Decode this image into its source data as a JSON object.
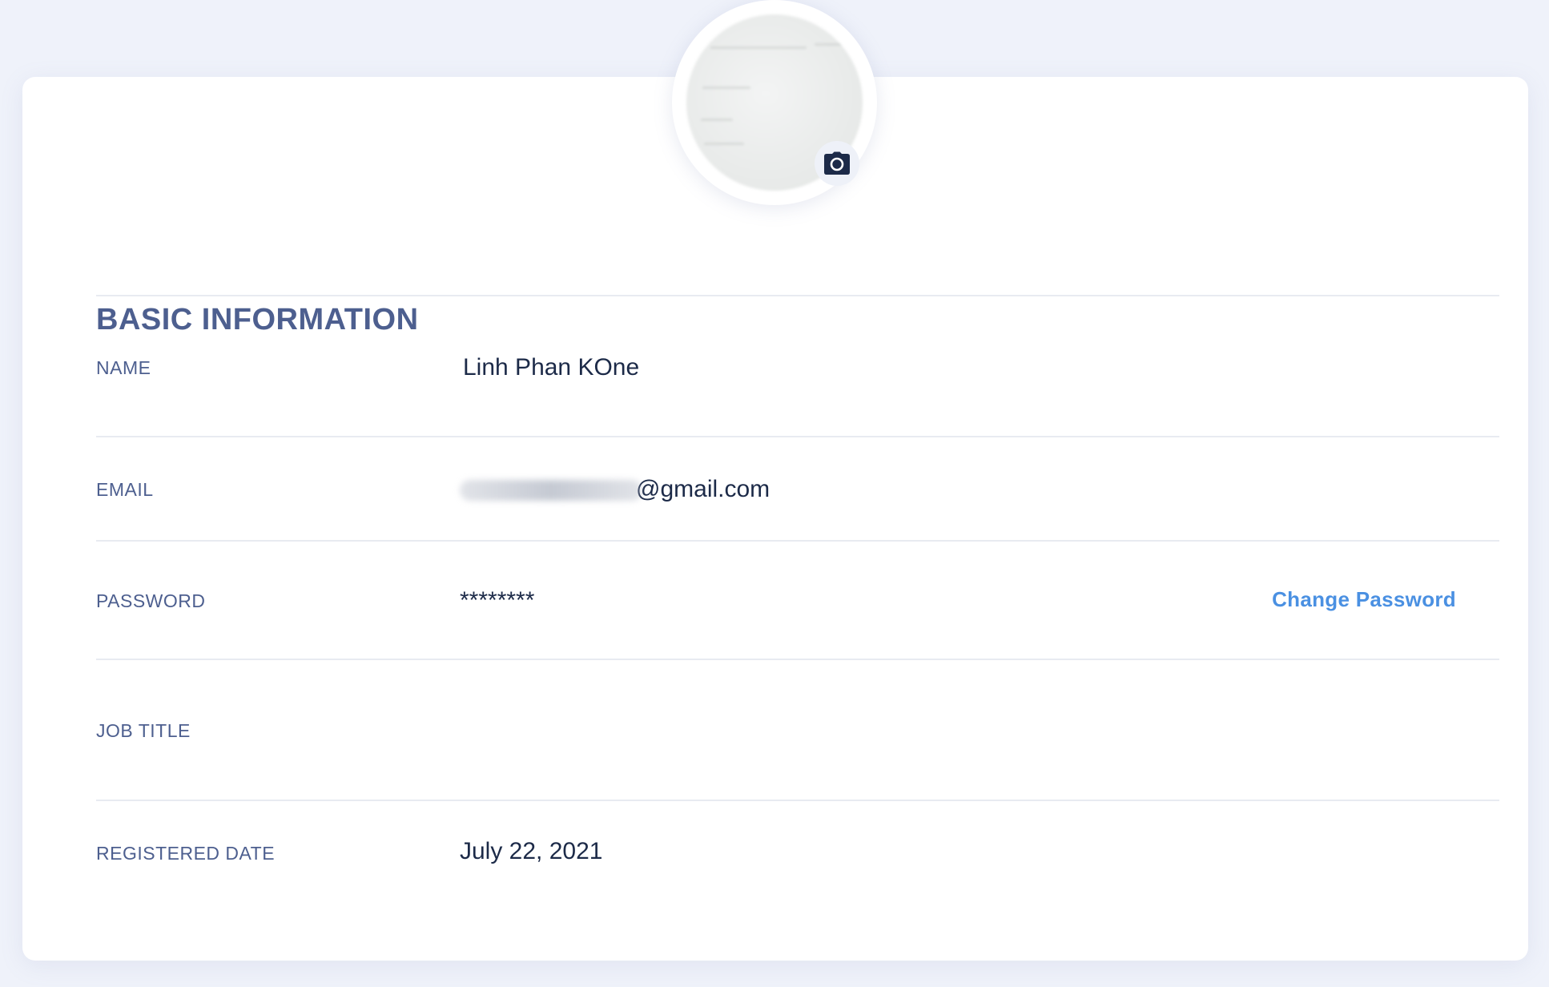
{
  "section": {
    "title": "BASIC INFORMATION"
  },
  "profile": {
    "avatar_icon": "camera-icon"
  },
  "fields": {
    "name": {
      "label": "NAME",
      "value": "Linh Phan KOne"
    },
    "email": {
      "label": "EMAIL",
      "value_visible": "@gmail.com"
    },
    "password": {
      "label": "PASSWORD",
      "value": "********",
      "action_label": "Change Password"
    },
    "job_title": {
      "label": "JOB TITLE",
      "value": ""
    },
    "registered_date": {
      "label": "REGISTERED DATE",
      "value": "July 22, 2021"
    }
  },
  "colors": {
    "background": "#eff2fa",
    "card": "#ffffff",
    "label": "#4d5f8f",
    "value": "#1c2a48",
    "link": "#4a90e2"
  }
}
